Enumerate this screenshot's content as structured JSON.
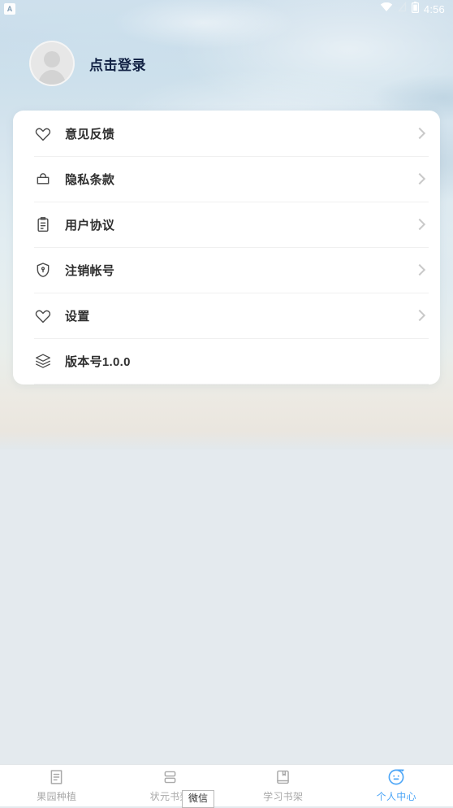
{
  "status_bar": {
    "app_badge": "A",
    "icons": [
      "wifi-icon",
      "signal-off-icon",
      "battery-icon"
    ],
    "time": "4:56"
  },
  "profile": {
    "avatar_icon": "default-user-avatar",
    "login_label": "点击登录"
  },
  "menu": {
    "items": [
      {
        "icon": "heart-icon",
        "label": "意见反馈",
        "chevron": true
      },
      {
        "icon": "bag-icon",
        "label": "隐私条款",
        "chevron": true
      },
      {
        "icon": "clipboard-icon",
        "label": "用户协议",
        "chevron": true
      },
      {
        "icon": "shield-icon",
        "label": "注销帐号",
        "chevron": true
      },
      {
        "icon": "heart-icon",
        "label": "设置",
        "chevron": true
      },
      {
        "icon": "layers-icon",
        "label": "版本号1.0.0",
        "chevron": false
      }
    ]
  },
  "tabbar": {
    "items": [
      {
        "icon": "note-icon",
        "label": "果园种植",
        "active": false
      },
      {
        "icon": "shelf-icon",
        "label": "状元书架",
        "active": false
      },
      {
        "icon": "book-icon",
        "label": "学习书架",
        "active": false
      },
      {
        "icon": "smiley-icon",
        "label": "个人中心",
        "active": true
      }
    ],
    "active_color": "#4da6f7",
    "inactive_color": "#a9a9a9"
  },
  "overlay": {
    "wechat_tip": "微信"
  }
}
